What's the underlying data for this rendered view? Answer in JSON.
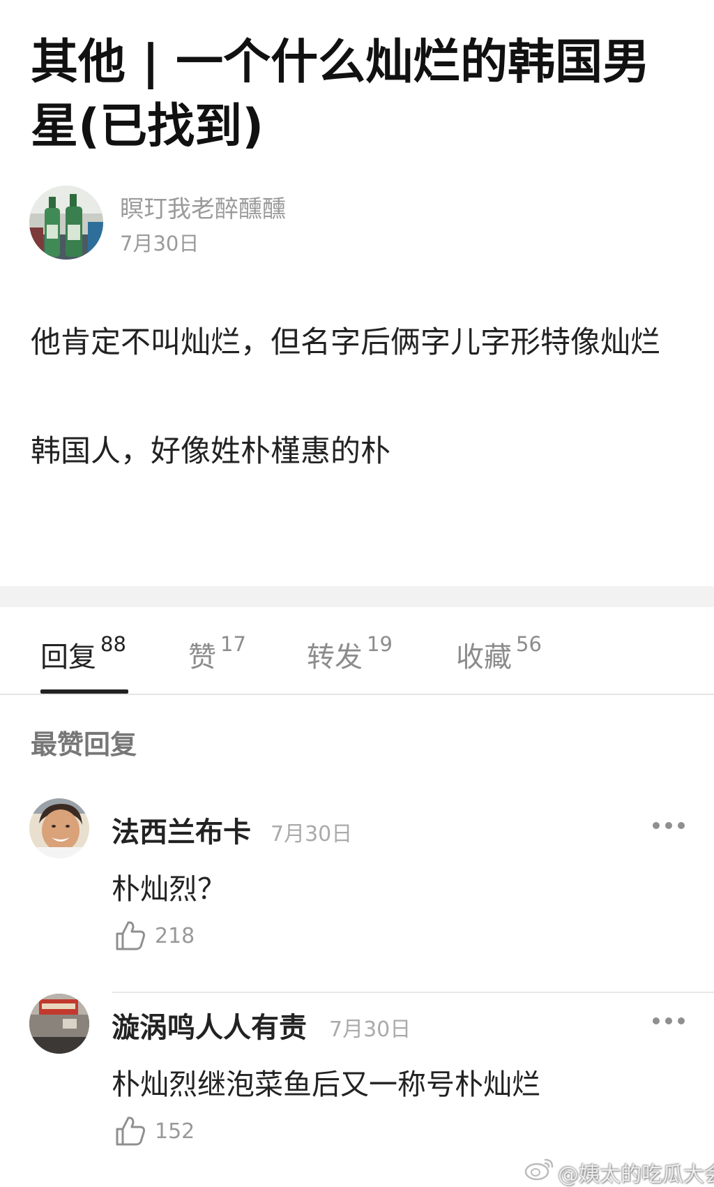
{
  "post": {
    "title": "其他 | 一个什么灿烂的韩国男星(已找到)",
    "author": {
      "name": "瞑玎我老醉醺醺",
      "date": "7月30日"
    },
    "body": [
      "他肯定不叫灿烂，但名字后俩字儿字形特像灿烂",
      "韩国人，好像姓朴槿惠的朴"
    ]
  },
  "tabs": [
    {
      "label": "回复",
      "count": "88",
      "active": true
    },
    {
      "label": "赞",
      "count": "17",
      "active": false
    },
    {
      "label": "转发",
      "count": "19",
      "active": false
    },
    {
      "label": "收藏",
      "count": "56",
      "active": false
    }
  ],
  "section_title": "最赞回复",
  "comments": [
    {
      "name": "法西兰布卡",
      "date": "7月30日",
      "text": "朴灿烈？",
      "likes": "218"
    },
    {
      "name": "漩涡鸣人人有责",
      "date": "7月30日",
      "text": "朴灿烈继泡菜鱼后又一称号朴灿烂",
      "likes": "152"
    }
  ],
  "watermark": {
    "text": "@姨太的吃瓜大会",
    "icon": "weibo-icon"
  },
  "colors": {
    "text": "#222222",
    "muted": "#9a9a9a",
    "band": "#f2f2f2",
    "indicator": "#222222"
  }
}
